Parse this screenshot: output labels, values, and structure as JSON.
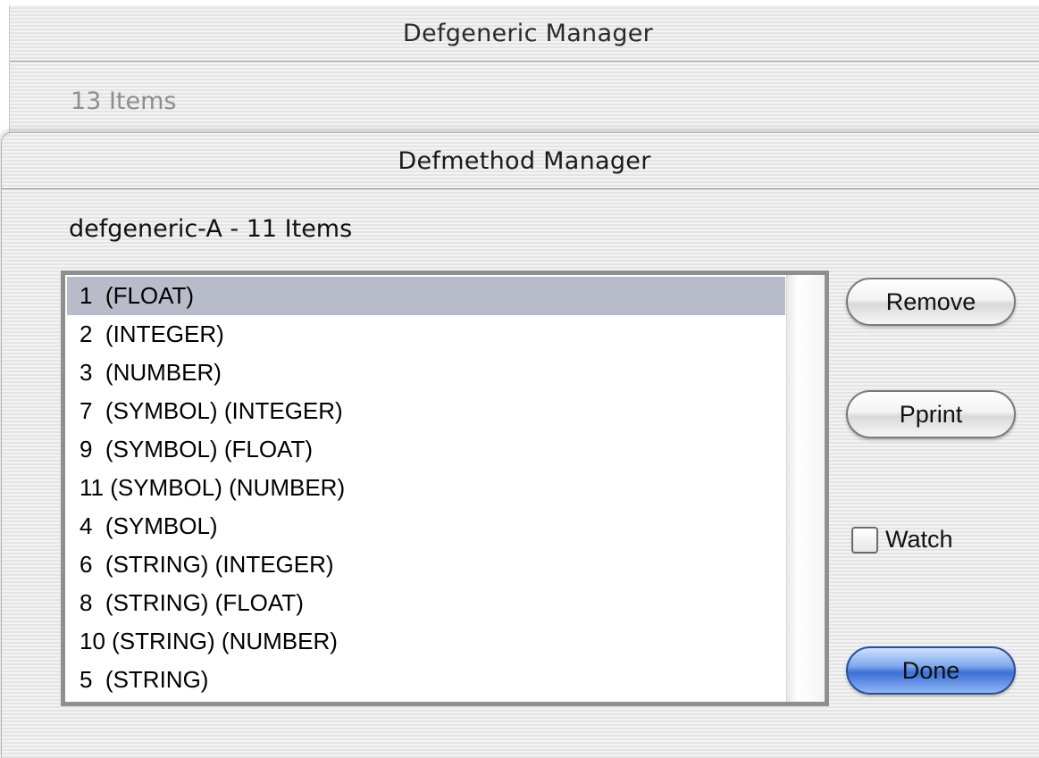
{
  "back_window": {
    "title": "Defgeneric Manager",
    "item_count_text": "13 Items"
  },
  "front_window": {
    "title": "Defmethod Manager",
    "list_header": "defgeneric-A - 11 Items",
    "list": {
      "selected_index": 0,
      "items": [
        "1  (FLOAT)",
        "2  (INTEGER)",
        "3  (NUMBER)",
        "7  (SYMBOL) (INTEGER)",
        "9  (SYMBOL) (FLOAT)",
        "11 (SYMBOL) (NUMBER)",
        "4  (SYMBOL)",
        "6  (STRING) (INTEGER)",
        "8  (STRING) (FLOAT)",
        "10 (STRING) (NUMBER)",
        "5  (STRING)"
      ]
    },
    "buttons": {
      "remove_label": "Remove",
      "pprint_label": "Pprint",
      "done_label": "Done"
    },
    "watch": {
      "label": "Watch",
      "checked": false
    }
  }
}
